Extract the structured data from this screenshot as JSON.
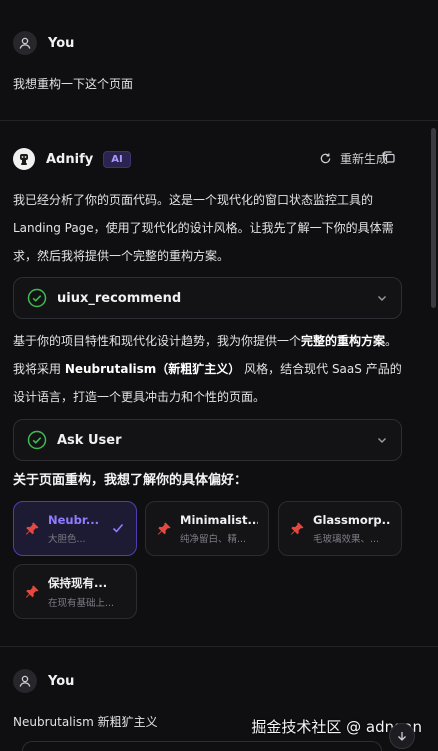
{
  "messages": {
    "user1": {
      "name": "You",
      "text": "我想重构一下这个页面"
    },
    "assistant": {
      "name": "Adnify",
      "badge": "AI",
      "regenerate_label": "重新生成",
      "para1": "我已经分析了你的页面代码。这是一个现代化的窗口状态监控工具的 Landing Page，使用了现代化的设计风格。让我先了解一下你的具体需求，然后我将提供一个完整的重构方案。",
      "tool1": "uiux_recommend",
      "para2": {
        "part1": "基于你的项目特性和现代化设计趋势，我为你提供一个",
        "bold1": "完整的重构方案",
        "part2": "。我将采用 ",
        "bold2": "Neubrutalism（新粗犷主义）",
        "part3": " 风格，结合现代 SaaS 产品的设计语言，打造一个更具冲击力和个性的页面。"
      },
      "tool2": "Ask User",
      "question": "关于页面重构，我想了解你的具体偏好：",
      "options": [
        {
          "title": "Neubr...",
          "desc": "大胆色...",
          "selected": true
        },
        {
          "title": "Minimalist...",
          "desc": "纯净留白、精...",
          "selected": false
        },
        {
          "title": "Glassmorp...",
          "desc": "毛玻璃效果、...",
          "selected": false
        },
        {
          "title": "保持现有...",
          "desc": "在现有基础上...",
          "selected": false
        }
      ]
    },
    "user2": {
      "name": "You",
      "text": "Neubrutalism 新粗犷主义"
    }
  },
  "watermark": "掘金技术社区 @ adnaan",
  "colors": {
    "accent": "#7c6cff",
    "success": "#3fb950",
    "background": "#0f0f11"
  }
}
